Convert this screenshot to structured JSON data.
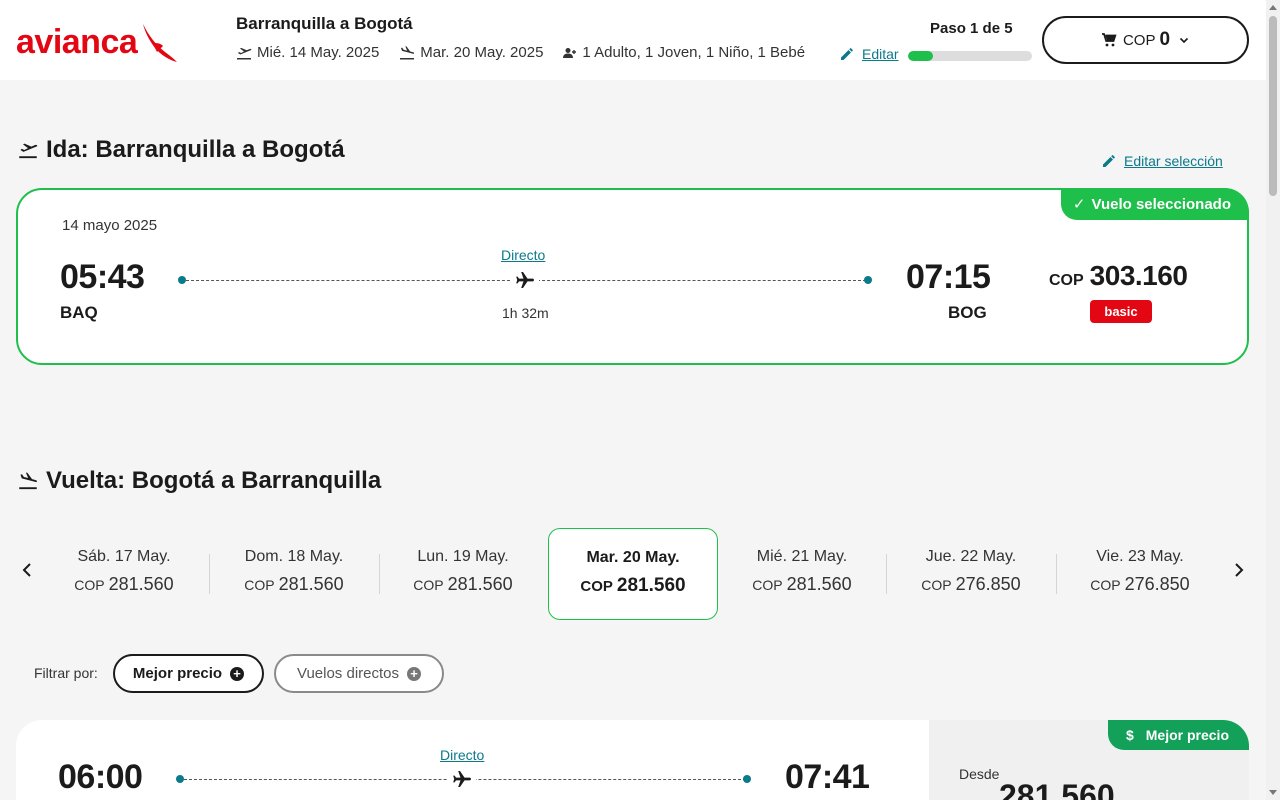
{
  "brand": {
    "name": "avianca",
    "accent": "#e30613",
    "green": "#1fbf4b",
    "teal": "#0b7a8a"
  },
  "header": {
    "route_title": "Barranquilla a Bogotá",
    "depart_date": "Mié. 14 May. 2025",
    "return_date": "Mar. 20 May. 2025",
    "passengers": "1 Adulto, 1 Joven, 1 Niño, 1 Bebé",
    "edit_label": "Editar",
    "step_label": "Paso 1 de 5",
    "progress_fraction": 0.2,
    "cart_currency": "COP",
    "cart_amount": "0"
  },
  "outbound": {
    "title": "Ida: Barranquilla a Bogotá",
    "edit_selection": "Editar selección",
    "badge": "Vuelo seleccionado",
    "date": "14 mayo 2025",
    "dep_time": "05:43",
    "dep_code": "BAQ",
    "arr_time": "07:15",
    "arr_code": "BOG",
    "stops": "Directo",
    "duration": "1h 32m",
    "currency": "COP",
    "price": "303.160",
    "fare": "basic"
  },
  "return": {
    "title": "Vuelta: Bogotá a Barranquilla",
    "dates": [
      {
        "day": "Sáb. 17 May.",
        "currency": "COP",
        "price": "281.560"
      },
      {
        "day": "Dom. 18 May.",
        "currency": "COP",
        "price": "281.560"
      },
      {
        "day": "Lun. 19 May.",
        "currency": "COP",
        "price": "281.560"
      },
      {
        "day": "Mar. 20 May.",
        "currency": "COP",
        "price": "281.560"
      },
      {
        "day": "Mié. 21 May.",
        "currency": "COP",
        "price": "281.560"
      },
      {
        "day": "Jue. 22 May.",
        "currency": "COP",
        "price": "276.850"
      },
      {
        "day": "Vie. 23 May.",
        "currency": "COP",
        "price": "276.850"
      }
    ],
    "selected_index": 3
  },
  "filters": {
    "label": "Filtrar por:",
    "best_price": "Mejor precio",
    "direct": "Vuelos directos"
  },
  "result1": {
    "badge": "Mejor precio",
    "stops": "Directo",
    "dep_time": "06:00",
    "arr_time": "07:41",
    "from_label": "Desde",
    "price": "281.560"
  }
}
